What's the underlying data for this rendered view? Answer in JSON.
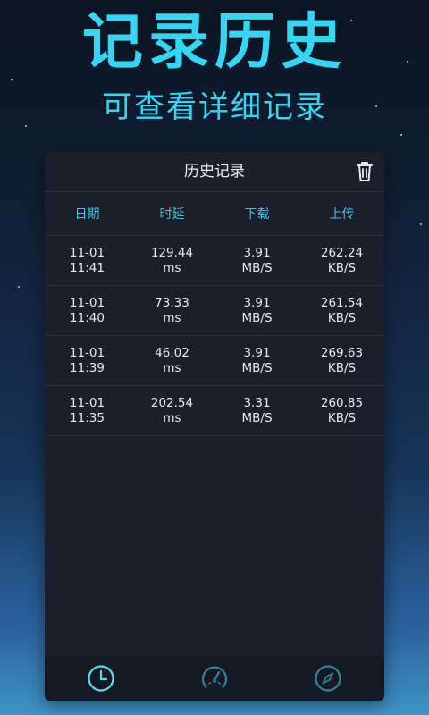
{
  "hero": {
    "title": "记录历史",
    "subtitle": "可查看详细记录"
  },
  "card": {
    "title": "历史记录",
    "columns": [
      "日期",
      "时延",
      "下载",
      "上传"
    ],
    "rows": [
      {
        "date": "11-01",
        "time": "11:41",
        "latency": "129.44",
        "latency_unit": "ms",
        "download": "3.91",
        "download_unit": "MB/S",
        "upload": "262.24",
        "upload_unit": "KB/S"
      },
      {
        "date": "11-01",
        "time": "11:40",
        "latency": "73.33",
        "latency_unit": "ms",
        "download": "3.91",
        "download_unit": "MB/S",
        "upload": "261.54",
        "upload_unit": "KB/S"
      },
      {
        "date": "11-01",
        "time": "11:39",
        "latency": "46.02",
        "latency_unit": "ms",
        "download": "3.91",
        "download_unit": "MB/S",
        "upload": "269.63",
        "upload_unit": "KB/S"
      },
      {
        "date": "11-01",
        "time": "11:35",
        "latency": "202.54",
        "latency_unit": "ms",
        "download": "3.31",
        "download_unit": "MB/S",
        "upload": "260.85",
        "upload_unit": "KB/S"
      }
    ]
  },
  "nav": {
    "items": [
      {
        "icon": "clock-icon",
        "active": true
      },
      {
        "icon": "speedometer-icon",
        "active": false
      },
      {
        "icon": "compass-icon",
        "active": false
      }
    ]
  },
  "colors": {
    "accent": "#35d6f2",
    "header_text": "#3fc4e8",
    "card_bg": "#1a1f2a",
    "nav_inactive": "#3a7f9a"
  }
}
